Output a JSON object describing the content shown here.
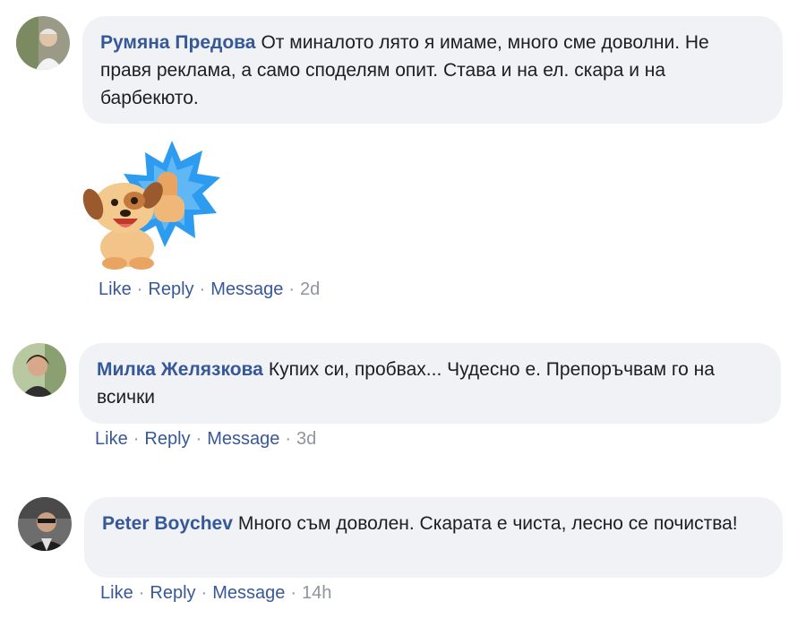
{
  "comments": [
    {
      "author": "Румяна Предова",
      "text": "От миналото лято я имаме, много сме доволни. Не правя реклама, а само споделям опит. Става и на ел. скара и на барбекюто.",
      "actions": {
        "like": "Like",
        "reply": "Reply",
        "message": "Message",
        "time": "2d"
      }
    },
    {
      "author": "Милка Желязкова",
      "text": "Купих си, пробвах... Чудесно е. Препоръчвам го на всички",
      "actions": {
        "like": "Like",
        "reply": "Reply",
        "message": "Message",
        "time": "3d"
      }
    },
    {
      "author": "Peter Boychev",
      "text": "Много съм доволен. Скарата е чиста, лесно се почиства!",
      "actions": {
        "like": "Like",
        "reply": "Reply",
        "message": "Message",
        "time": "14h"
      }
    }
  ],
  "separator": "·",
  "sticker": {
    "icon": "thumbs-up-puppy-sticker"
  },
  "colors": {
    "author": "#365899",
    "link": "#385898",
    "bubble": "#f0f2f5",
    "meta": "#90949c",
    "sticker_burst": "#2d9cf0"
  }
}
